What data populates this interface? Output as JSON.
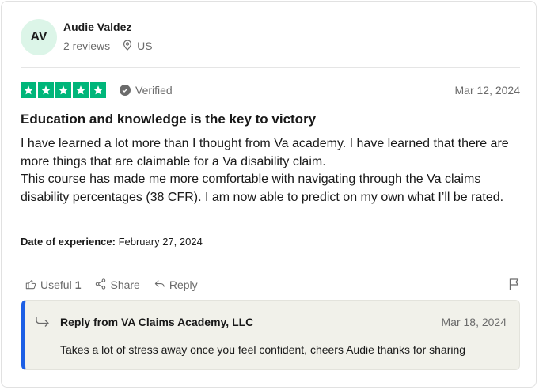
{
  "user": {
    "initials": "AV",
    "name": "Audie Valdez",
    "reviews_count": "2 reviews",
    "location": "US"
  },
  "review": {
    "rating": 5,
    "max_rating": 5,
    "verified_label": "Verified",
    "date": "Mar 12, 2024",
    "title": "Education and knowledge is the key to victory",
    "paragraphs": [
      "I have learned a lot more than I thought from Va academy. I have learned that there are more things that are claimable for a Va disability claim.",
      "This course has made me more comfortable with navigating through the Va claims disability percentages (38 CFR). I am now able to predict on my own what I’ll be rated."
    ],
    "experience_label": "Date of experience:",
    "experience_date": "February 27, 2024"
  },
  "actions": {
    "useful_label": "Useful",
    "useful_count": "1",
    "share_label": "Share",
    "reply_label": "Reply"
  },
  "reply": {
    "from": "Reply from VA Claims Academy, LLC",
    "date": "Mar 18, 2024",
    "text": "Takes a lot of stress away once you feel confident, cheers Audie thanks for sharing"
  },
  "colors": {
    "star_green": "#00b67a",
    "avatar_bg": "#dcf5e8",
    "reply_accent": "#1c5fe5",
    "reply_bg": "#f1f1ea"
  },
  "icons": [
    "location-pin-icon",
    "star-icon",
    "check-icon",
    "thumbs-up-icon",
    "share-icon",
    "reply-icon",
    "flag-icon",
    "reply-arrow-icon"
  ]
}
